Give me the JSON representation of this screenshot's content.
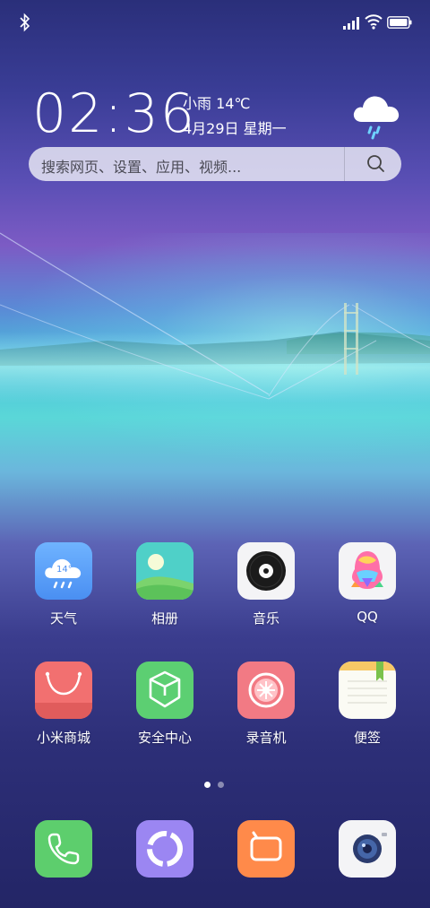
{
  "status_bar": {
    "bluetooth_icon": "bluetooth-icon",
    "signal_icon": "signal-icon",
    "wifi_icon": "wifi-icon",
    "battery_icon": "battery-icon"
  },
  "widget": {
    "time": "02:36",
    "weather": "小雨 14℃",
    "date": "4月29日 星期一",
    "weather_icon": "rain-cloud-icon"
  },
  "search": {
    "placeholder": "搜索网页、设置、应用、视频..."
  },
  "apps_row1": [
    {
      "label": "天气",
      "icon": "weather-icon",
      "badge": "14°"
    },
    {
      "label": "相册",
      "icon": "gallery-icon"
    },
    {
      "label": "音乐",
      "icon": "music-icon"
    },
    {
      "label": "QQ",
      "icon": "qq-icon"
    }
  ],
  "apps_row2": [
    {
      "label": "小米商城",
      "icon": "mi-store-icon"
    },
    {
      "label": "安全中心",
      "icon": "security-icon"
    },
    {
      "label": "录音机",
      "icon": "recorder-icon"
    },
    {
      "label": "便签",
      "icon": "notes-icon"
    }
  ],
  "dock": [
    {
      "icon": "phone-icon"
    },
    {
      "icon": "contacts-icon"
    },
    {
      "icon": "messages-icon"
    },
    {
      "icon": "camera-icon"
    }
  ],
  "page_indicator": {
    "pages": 2,
    "current": 1
  },
  "colors": {
    "accent": "#5b7dd6"
  }
}
